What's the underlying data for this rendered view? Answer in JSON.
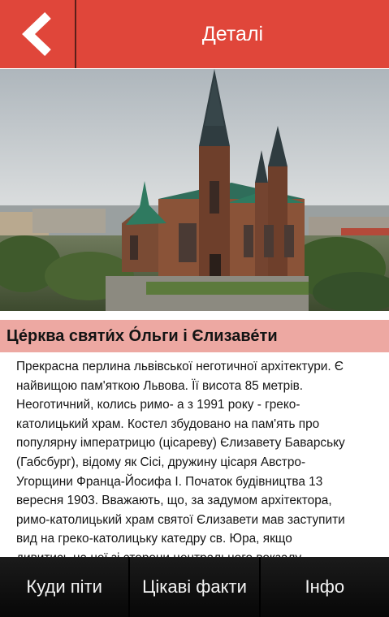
{
  "header": {
    "back_icon": "chevron-left-icon",
    "title": "Деталі"
  },
  "photo": {
    "subject": "church-photo"
  },
  "article": {
    "title": "Це́рква святи́х О́льги і Єлизаве́ти",
    "lines": [
      "Прекрасна перлина львівської неготичної архітектури. Є",
      "найвищою пам'яткою Львова. Її висота 85 метрів.",
      "Неоготичний, колись римо- а з 1991 року - греко-",
      "католицький храм. Костел збудовано на пам'ять про",
      "популярну імператрицю (цісареву) Єлизавету Баварську",
      "(Габсбург), відому як Сісі, дружину цісаря Австро-",
      "Угорщини Франца-Йосифа I. Початок будівництва 13",
      "вересня 1903. Вважають, що, за задумом архітектора,",
      "римо-католицький храм святої Єлизавети мав заступити",
      "вид на греко-католицьку катедру св. Юра, якщо",
      "дивитись на неї зі сторони центрального вокзалу."
    ]
  },
  "bottom_nav": {
    "tabs": [
      "Куди піти",
      "Цікаві факти",
      "Інфо"
    ]
  },
  "colors": {
    "header_bg": "#e0463a",
    "heading_band": "#eda8a2",
    "nav_bg": "#111111"
  }
}
